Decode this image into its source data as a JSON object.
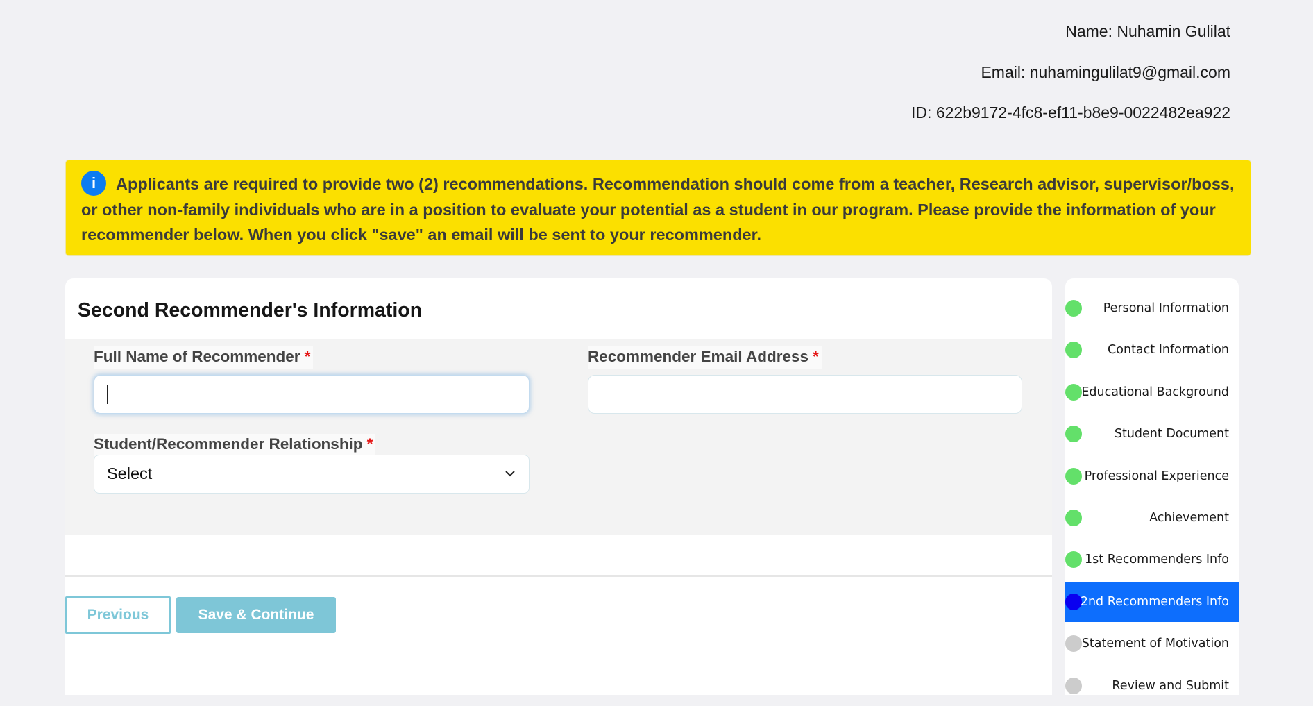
{
  "user": {
    "name": "Name: Nuhamin Gulilat",
    "email": "Email: nuhamingulilat9@gmail.com",
    "id": "ID: 622b9172-4fc8-ef11-b8e9-0022482ea922"
  },
  "banner": {
    "icon": "info-icon",
    "icon_glyph": "i",
    "text": "Applicants are required to provide two (2) recommendations. Recommendation should come from a teacher, Research advisor, supervisor/boss, or other non-family individuals who are in a position to evaluate your potential as a student in our program. Please provide the information of your recommender below. When you click \"save\" an email will be sent to your recommender.",
    "color": "#fbe000"
  },
  "form": {
    "title": "Second Recommender's Information",
    "required_mark": "*",
    "fields": {
      "full_name": {
        "label": "Full Name of Recommender",
        "value": "",
        "placeholder": ""
      },
      "email": {
        "label": "Recommender Email Address",
        "value": "",
        "placeholder": ""
      },
      "relationship": {
        "label": "Student/Recommender Relationship",
        "selected": "Select"
      }
    }
  },
  "actions": {
    "previous_label": "Previous",
    "save_label": "Save & Continue"
  },
  "steps": [
    {
      "label": "Personal Information",
      "status": "complete"
    },
    {
      "label": "Contact Information",
      "status": "complete"
    },
    {
      "label": "Educational Background",
      "status": "complete"
    },
    {
      "label": "Student Document",
      "status": "complete"
    },
    {
      "label": "Professional Experience",
      "status": "complete"
    },
    {
      "label": "Achievement",
      "status": "complete"
    },
    {
      "label": "1st Recommenders Info",
      "status": "complete"
    },
    {
      "label": "2nd Recommenders Info",
      "status": "current"
    },
    {
      "label": "Statement of Motivation",
      "status": "pending"
    },
    {
      "label": "Review and Submit",
      "status": "pending"
    }
  ],
  "colors": {
    "complete": "#63e06a",
    "current": "#0a00f0",
    "pending": "#cccccc",
    "active_bg": "#0d6efd",
    "button_accent": "#7ec6d7"
  }
}
